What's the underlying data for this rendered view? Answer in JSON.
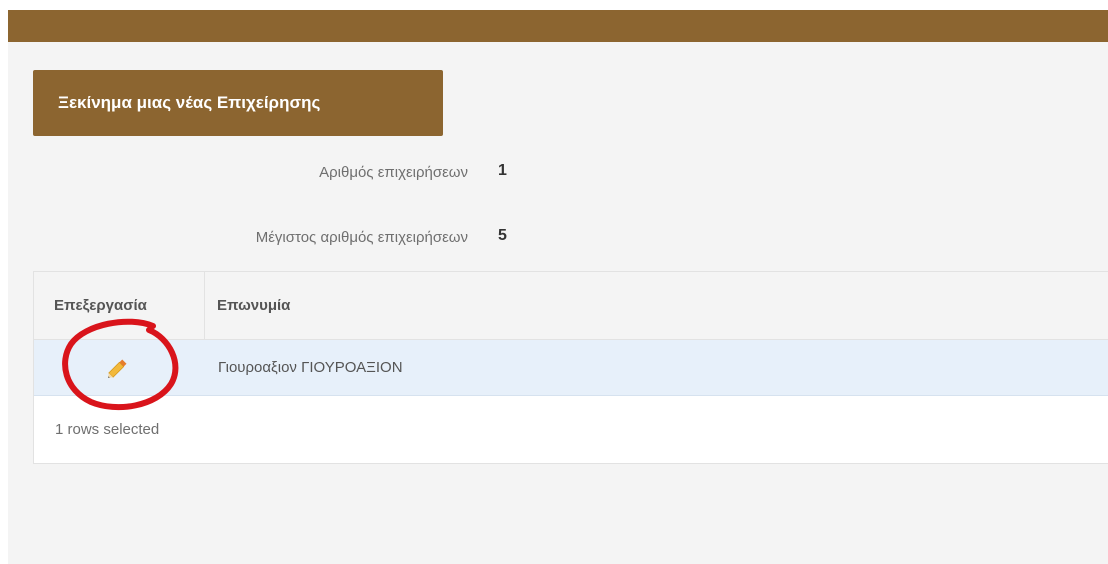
{
  "toolbar": {
    "start_business_label": "Ξεκίνημα μιας νέας Επιχείρησης"
  },
  "stats": {
    "business_count": {
      "label": "Αριθμός επιχειρήσεων",
      "value": "1"
    },
    "max_business_count": {
      "label": "Μέγιστος αριθμός επιχειρήσεων",
      "value": "5"
    }
  },
  "grid": {
    "columns": [
      "Επεξεργασία",
      "Επωνυμία"
    ],
    "rows": [
      {
        "edit_icon": "pencil-icon",
        "name": "Γιουροαξιον ΓΙΟΥΡΟΑΞΙΟΝ",
        "selected": true
      }
    ],
    "footer": "1 rows selected"
  },
  "colors": {
    "brand": "#8c6530",
    "selected_row": "#e7f0fa",
    "annotation": "#d9141b"
  }
}
